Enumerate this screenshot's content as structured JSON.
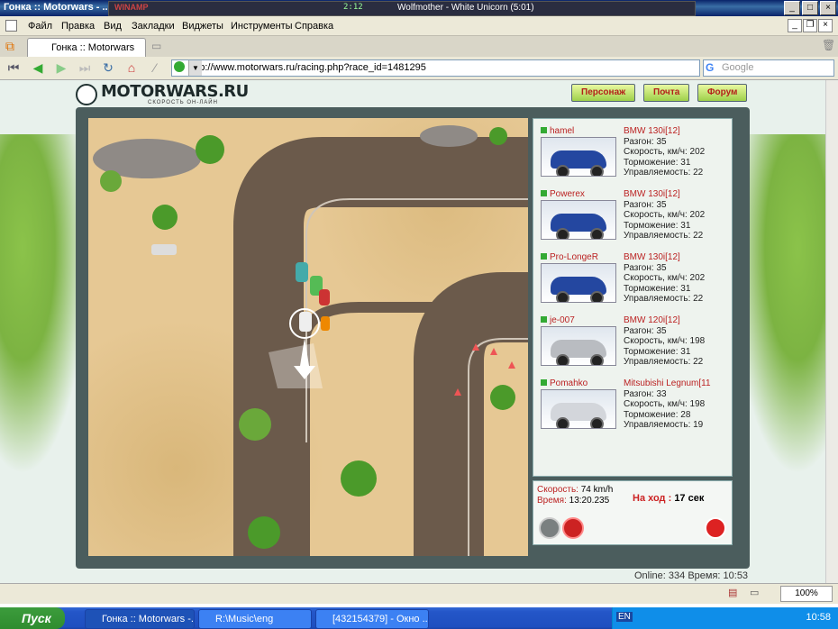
{
  "window": {
    "title": "Гонка :: Motorwars - ...",
    "winamp_label": "WINAMP",
    "winamp_time": "2:12",
    "winamp_song": "Wolfmother - White Unicorn (5:01)"
  },
  "menu": [
    "Файл",
    "Правка",
    "Вид",
    "Закладки",
    "Виджеты",
    "Инструменты",
    "Справка"
  ],
  "tab": {
    "label": "Гонка :: Motorwars"
  },
  "nav": {
    "url": "http://www.motorwars.ru/racing.php?race_id=1481295",
    "search_placeholder": "Google"
  },
  "site": {
    "logo": "MOTORWARS.RU",
    "tagline": "СКОРОСТЬ ОН-ЛАЙН",
    "buttons": [
      "Персонаж",
      "Почта",
      "Форум"
    ]
  },
  "players": [
    {
      "name": "hamel",
      "model": "BMW 130i[12]",
      "accel": "Разгон: 35",
      "speed": "Скорость, км/ч: 202",
      "brake": "Торможение: 31",
      "handling": "Управляемость: 22",
      "color": "#2447a0"
    },
    {
      "name": "Powerex",
      "model": "BMW 130i[12]",
      "accel": "Разгон: 35",
      "speed": "Скорость, км/ч: 202",
      "brake": "Торможение: 31",
      "handling": "Управляемость: 22",
      "color": "#2447a0"
    },
    {
      "name": "Pro-LongeR",
      "model": "BMW 130i[12]",
      "accel": "Разгон: 35",
      "speed": "Скорость, км/ч: 202",
      "brake": "Торможение: 31",
      "handling": "Управляемость: 22",
      "color": "#2447a0"
    },
    {
      "name": "je-007",
      "model": "BMW 120i[12]",
      "accel": "Разгон: 35",
      "speed": "Скорость, км/ч: 198",
      "brake": "Торможение: 31",
      "handling": "Управляемость: 22",
      "color": "#b9bcc1"
    },
    {
      "name": "Pomahko",
      "model": "Mitsubishi Legnum[11",
      "accel": "Разгон: 33",
      "speed": "Скорость, км/ч: 198",
      "brake": "Торможение: 28",
      "handling": "Управляемость: 19",
      "color": "#d3d6db"
    }
  ],
  "status": {
    "speed_label": "Скорость:",
    "speed_value": "74 km/h",
    "time_label": "Время:",
    "time_value": "13:20.235",
    "turn_label": "На ход :",
    "turn_value": "17 сек"
  },
  "online": "Online: 334   Время: 10:53",
  "zoom": "100%",
  "taskbar": {
    "start": "Пуск",
    "tasks": [
      "Гонка :: Motorwars -...",
      "R:\\Music\\eng",
      "[432154379] - Окно ..."
    ],
    "lang": "EN",
    "clock": "10:58"
  }
}
